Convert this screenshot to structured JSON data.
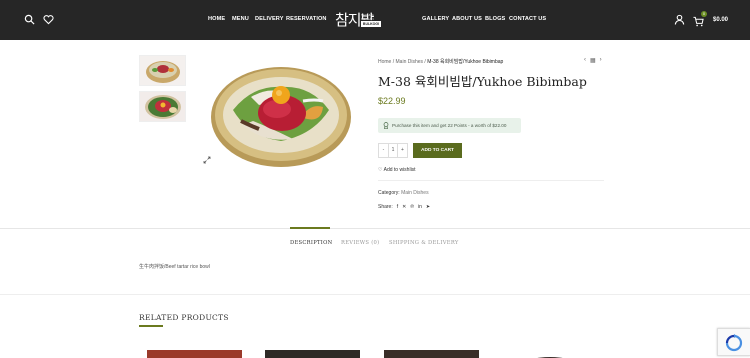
{
  "header": {
    "nav_left": [
      "HOME",
      "MENU",
      "DELIVERY",
      "RESERVATION"
    ],
    "nav_right": [
      "GALLERY",
      "ABOUT US",
      "BLOGS",
      "CONTACT US"
    ],
    "logo": {
      "korean": "참지밥",
      "sub_label": "SEOUL & KOREAN",
      "badge": "BULKOGI"
    },
    "cart_total": "$0.00",
    "cart_count": "0"
  },
  "product": {
    "breadcrumb": {
      "home": "Home",
      "sep": "/",
      "category": "Main Dishes",
      "current": "M-38 육회비빔밥/Yukhoe Bibimbap"
    },
    "title": "M-38 육회비빔밥/Yukhoe Bibimbap",
    "price": "$22.99",
    "points_text": "Purchase this item and get 22 Points - a worth of $22.00",
    "quantity": "1",
    "qty_minus": "-",
    "qty_plus": "+",
    "add_to_cart": "ADD TO CART",
    "wishlist": "Add to wishlist",
    "category_label": "Category:",
    "category_value": "Main Dishes",
    "share_label": "Share:"
  },
  "tabs": [
    {
      "label": "DESCRIPTION"
    },
    {
      "label": "REVIEWS (0)"
    },
    {
      "label": "SHIPPING & DELIVERY"
    }
  ],
  "description": "生牛肉拌饭/Beef tartar rice bowl",
  "related_title": "RELATED PRODUCTS",
  "colors": {
    "accent": "#5a6b1e",
    "header_bg": "#262626",
    "points_bg": "#e8f2ea"
  }
}
